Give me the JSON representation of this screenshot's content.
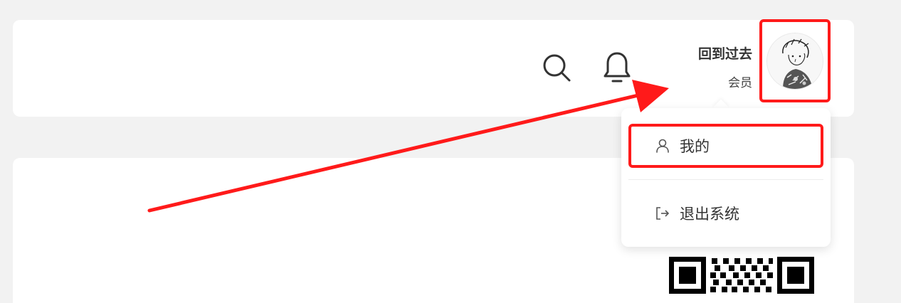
{
  "header": {
    "user_name": "回到过去",
    "user_role": "会员"
  },
  "icons": {
    "search": "search-icon",
    "bell": "bell-icon",
    "user": "user-icon",
    "logout": "logout-icon"
  },
  "dropdown": {
    "items": [
      {
        "label": "我的",
        "icon": "user-icon"
      },
      {
        "label": "退出系统",
        "icon": "logout-icon"
      }
    ]
  },
  "colors": {
    "highlight": "#ff1a1a",
    "background": "#f2f2f2",
    "card": "#ffffff"
  }
}
